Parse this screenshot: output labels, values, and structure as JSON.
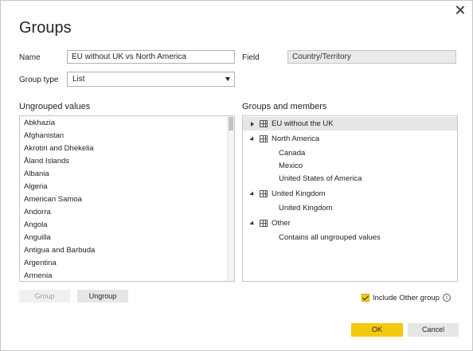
{
  "dialog": {
    "title": "Groups",
    "close_icon": "close-icon"
  },
  "form": {
    "name_label": "Name",
    "name_value": "EU without UK vs North America",
    "field_label": "Field",
    "field_value": "Country/Territory",
    "group_type_label": "Group type",
    "group_type_value": "List"
  },
  "ungrouped": {
    "heading": "Ungrouped values",
    "items": [
      "Abkhazia",
      "Afghanistan",
      "Akrotiri and Dhekelia",
      "Åland Islands",
      "Albania",
      "Algeria",
      "American Samoa",
      "Andorra",
      "Angola",
      "Anguilla",
      "Antigua and Barbuda",
      "Argentina",
      "Armenia"
    ]
  },
  "groups": {
    "heading": "Groups and members",
    "items": [
      {
        "label": "EU without the UK",
        "expanded": false,
        "selected": true,
        "members": []
      },
      {
        "label": "North America",
        "expanded": true,
        "selected": false,
        "members": [
          "Canada",
          "Mexico",
          "United States of America"
        ]
      },
      {
        "label": "United Kingdom",
        "expanded": true,
        "selected": false,
        "members": [
          "United Kingdom"
        ]
      },
      {
        "label": "Other",
        "expanded": true,
        "selected": false,
        "members": [
          "Contains all ungrouped values"
        ]
      }
    ]
  },
  "buttons": {
    "group": "Group",
    "ungroup": "Ungroup",
    "ok": "OK",
    "cancel": "Cancel"
  },
  "include_other": {
    "label": "Include Other group",
    "checked": true,
    "info_icon": "info-icon"
  },
  "colors": {
    "accent": "#f2c811",
    "selected_row": "#e6e6e6"
  }
}
